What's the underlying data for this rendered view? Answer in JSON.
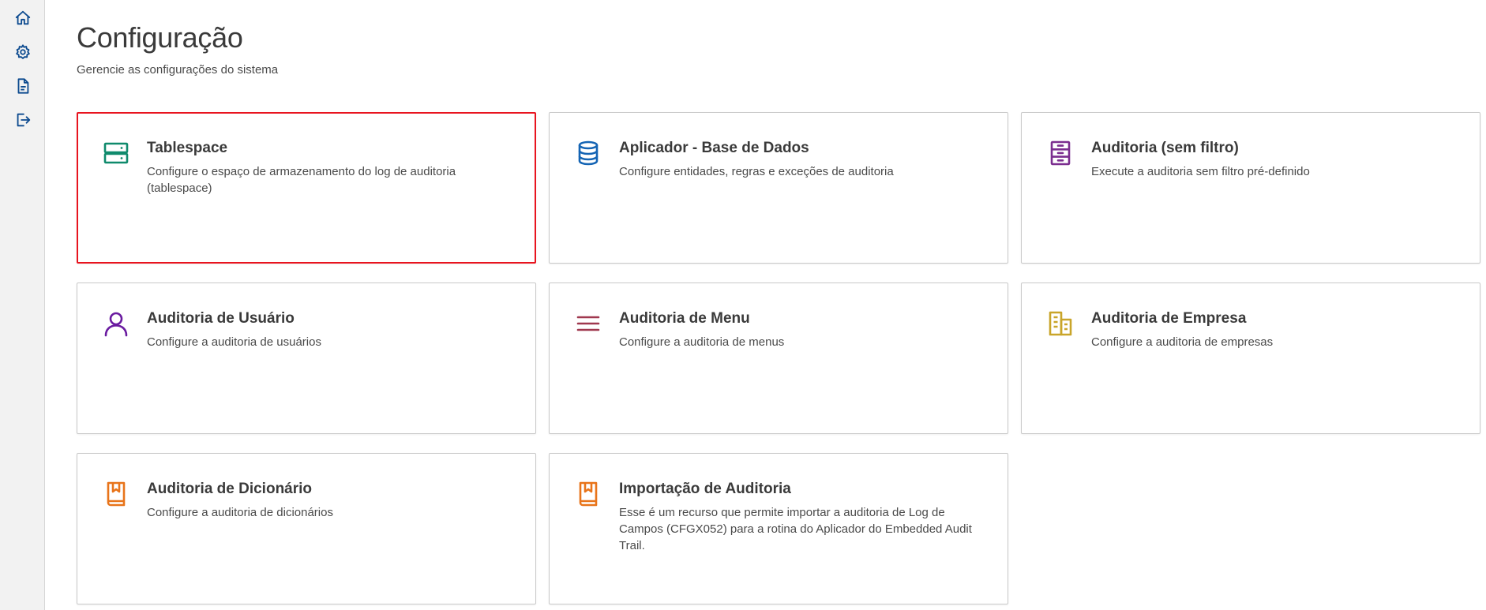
{
  "page": {
    "title": "Configuração",
    "subtitle": "Gerencie as configurações do sistema"
  },
  "sidebar": {
    "items": [
      {
        "icon": "home-icon"
      },
      {
        "icon": "gear-icon"
      },
      {
        "icon": "document-icon"
      },
      {
        "icon": "logout-icon"
      }
    ]
  },
  "colors": {
    "accent": "#0c4a8f",
    "selected_border": "#e8141f",
    "tablespace_icon": "#0f8a6c",
    "database_icon": "#1464b4",
    "filter_icon": "#7b2e8f",
    "user_icon": "#6a1ba0",
    "menu_icon": "#a0384f",
    "company_icon": "#c9a52a",
    "dictionary_icon": "#e8741a"
  },
  "cards": [
    {
      "title": "Tablespace",
      "description": "Configure o espaço de armazenamento do log de auditoria (tablespace)",
      "icon": "storage-icon",
      "selected": true
    },
    {
      "title": "Aplicador - Base de Dados",
      "description": "Configure entidades, regras e exceções de auditoria",
      "icon": "database-icon",
      "selected": false
    },
    {
      "title": "Auditoria (sem filtro)",
      "description": "Execute a auditoria sem filtro pré-definido",
      "icon": "cabinet-icon",
      "selected": false
    },
    {
      "title": "Auditoria de Usuário",
      "description": "Configure a auditoria de usuários",
      "icon": "user-icon",
      "selected": false
    },
    {
      "title": "Auditoria de Menu",
      "description": "Configure a auditoria de menus",
      "icon": "menu-icon",
      "selected": false
    },
    {
      "title": "Auditoria de Empresa",
      "description": "Configure a auditoria de empresas",
      "icon": "building-icon",
      "selected": false
    },
    {
      "title": "Auditoria de Dicionário",
      "description": "Configure a auditoria de dicionários",
      "icon": "book-icon",
      "selected": false
    },
    {
      "title": "Importação de Auditoria",
      "description": "Esse é um recurso que permite importar a auditoria de Log de Campos (CFGX052) para a rotina do Aplicador do Embedded Audit Trail.",
      "icon": "book-icon",
      "selected": false
    }
  ]
}
